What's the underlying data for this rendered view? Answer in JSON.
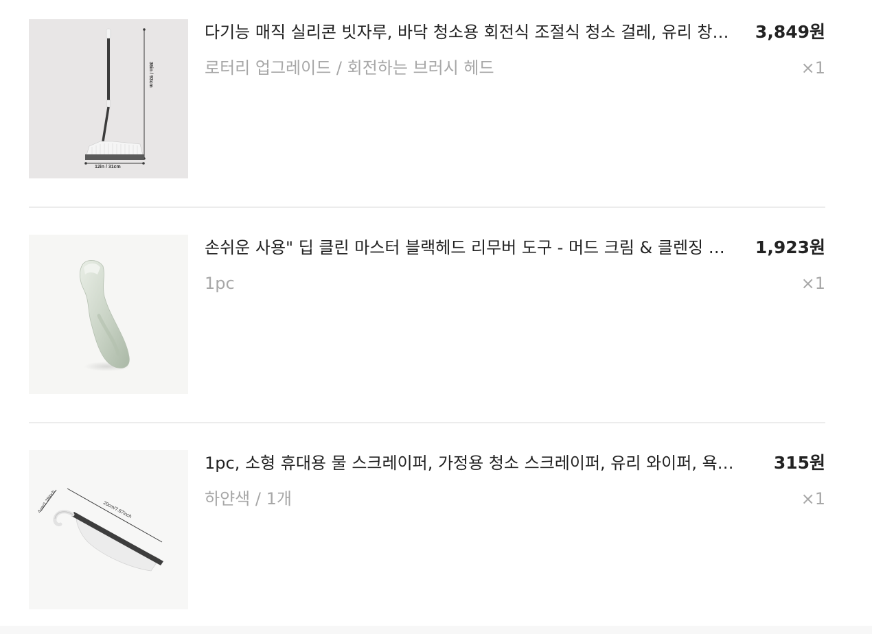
{
  "cart": {
    "items": [
      {
        "title": "다기능 매직 실리콘 빗자루, 바닥 청소용 회전식 조절식 청소 걸레, 유리 창문 닦기 도구",
        "price": "3,849원",
        "option": "로터리 업그레이드 / 회전하는 브러시 헤드",
        "quantity": "×1",
        "image": {
          "icon": "silicone-broom-image",
          "height_label": "36in / 93cm",
          "width_label": "12in / 31cm"
        }
      },
      {
        "title": "손쉬운 사용\" 딥 클린 마스터 블랙헤드 리무버 도구 - 머드 크림 & 클렌징 스크럽",
        "price": "1,923원",
        "option": "1pc",
        "quantity": "×1",
        "image": {
          "icon": "blackhead-remover-image"
        }
      },
      {
        "title": "1pc, 소형 휴대용 물 스크레이퍼, 가정용 청소 스크레이퍼, 유리 와이퍼, 욕실 청소 도구",
        "price": "315원",
        "option": "하얀색 / 1개",
        "quantity": "×1",
        "image": {
          "icon": "water-scraper-image",
          "length_label": "20cm/7.87inch",
          "height_label": "4cm/1.78inch"
        }
      }
    ]
  }
}
